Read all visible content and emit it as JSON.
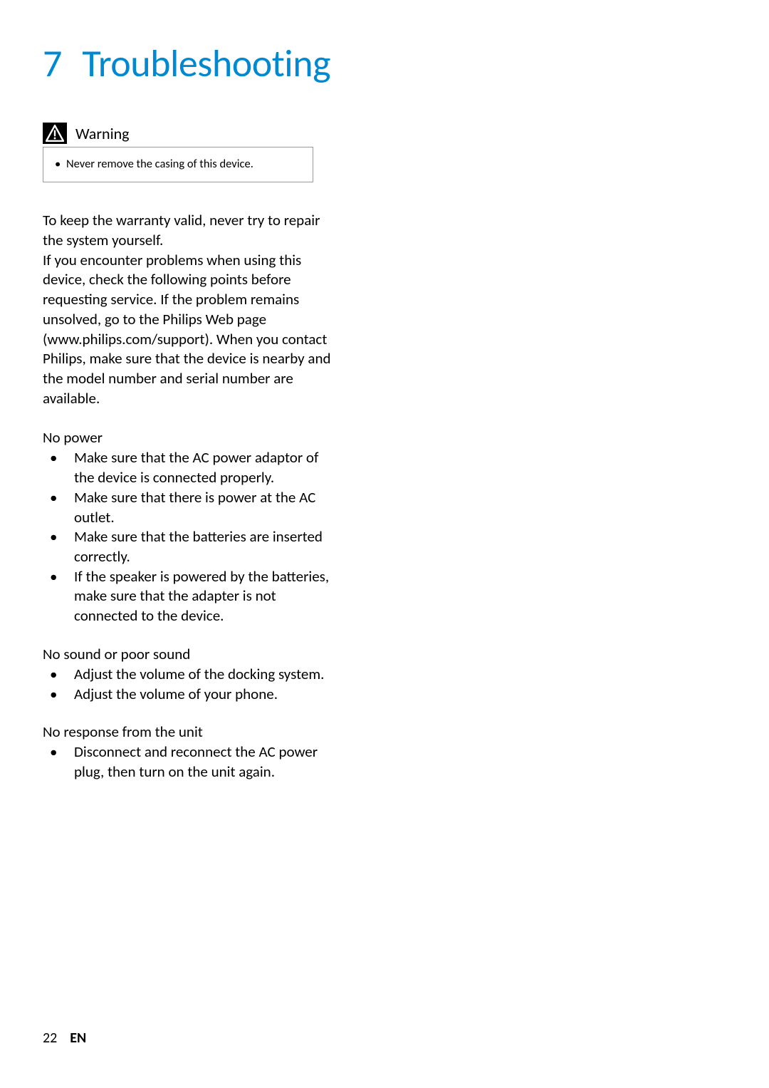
{
  "title": {
    "number": "7",
    "text": "Troubleshooting"
  },
  "warning": {
    "label": "Warning",
    "item": "Never remove the casing of this device."
  },
  "intro": "To keep the warranty valid, never try to repair the system yourself.\nIf you encounter problems when using this device, check the following points before requesting service. If the problem remains unsolved, go to the Philips Web page (www.philips.com/support). When you contact Philips, make sure that the device is nearby and the model number and serial number are available.",
  "sections": [
    {
      "heading": "No power",
      "items": [
        "Make sure that the AC power adaptor of the device is connected properly.",
        "Make sure that there is power at the AC outlet.",
        "Make sure that the batteries are inserted correctly.",
        "If the speaker is powered by the batteries, make sure that the adapter is not connected to the device."
      ]
    },
    {
      "heading": "No sound or poor sound",
      "items": [
        "Adjust the volume of the docking system.",
        "Adjust the volume of your phone."
      ]
    },
    {
      "heading": "No response from the unit",
      "items": [
        "Disconnect and reconnect the AC power plug, then turn on the unit again."
      ]
    }
  ],
  "footer": {
    "page": "22",
    "lang": "EN"
  }
}
